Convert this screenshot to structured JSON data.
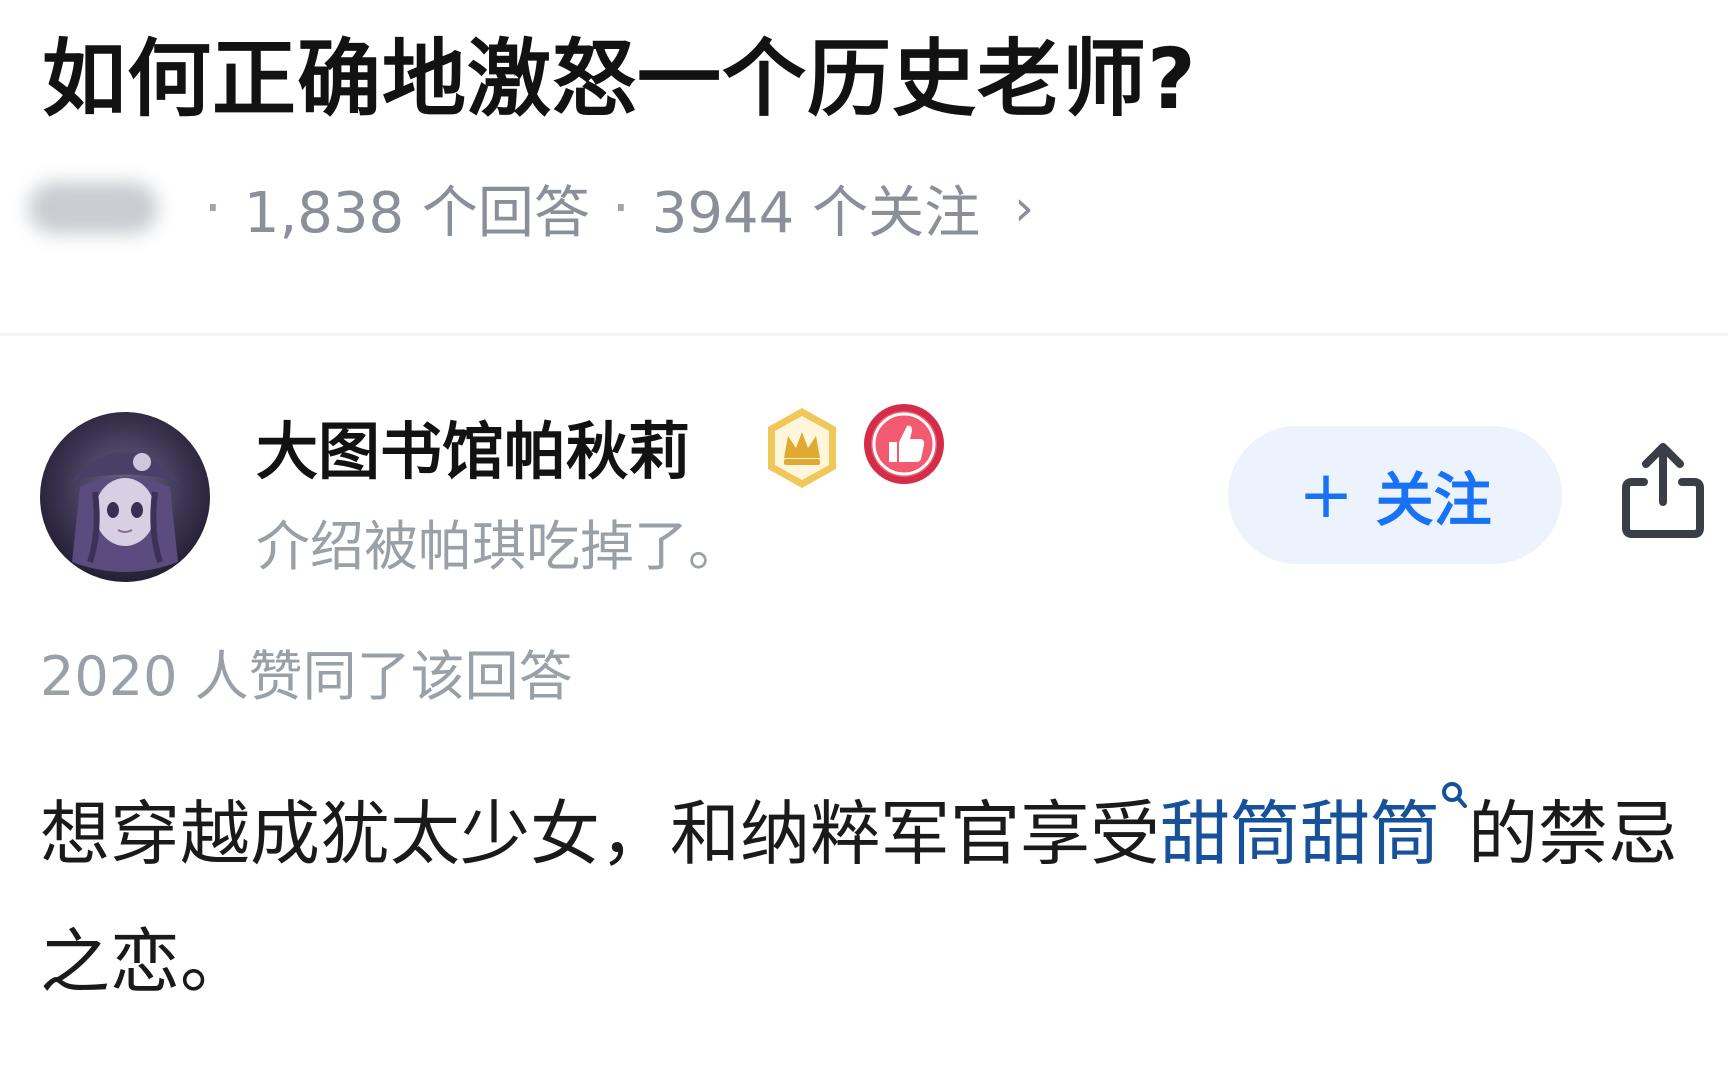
{
  "question": {
    "title": "如何正确地激怒一个历史老师?",
    "answer_count": "1,838 个回答",
    "follower_count": "3944 个关注",
    "chevron": "›"
  },
  "answer": {
    "author": {
      "name": "大图书馆帕秋莉",
      "bio": "介绍被帕琪吃掉了。",
      "badges": [
        "crown-badge-icon",
        "thumbs-up-badge-icon"
      ]
    },
    "follow_button": {
      "plus": "+",
      "label": "关注"
    },
    "vote_text": "2020 人赞同了该回答",
    "body": {
      "text_before": "想穿越成犹太少女，和纳粹军官享受",
      "link_text": "甜筒甜筒",
      "text_after": "的禁忌之恋。"
    }
  },
  "colors": {
    "link": "#175199",
    "follow_button_text": "#1772f6",
    "follow_button_bg": "#edf3fc",
    "meta_text": "#8a8f99",
    "crown_badge": "#e6b84a",
    "like_badge": "#e0334d"
  },
  "icons": {
    "share": "share-icon",
    "search_mini": "search-icon"
  }
}
